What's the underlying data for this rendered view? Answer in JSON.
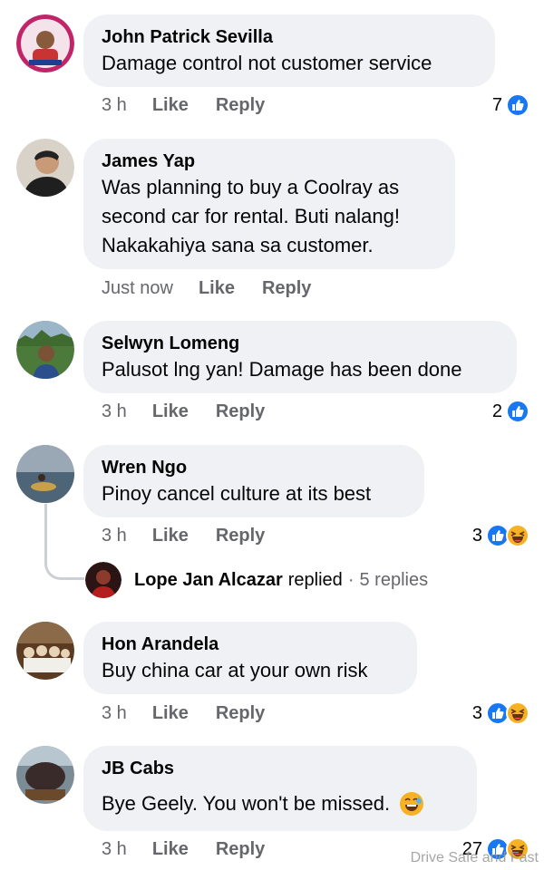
{
  "comments": [
    {
      "name": "John Patrick Sevilla",
      "lines": [
        "Damage control not customer service"
      ],
      "time": "3 h",
      "like_label": "Like",
      "reply_label": "Reply",
      "reaction_count": "7",
      "reactions": [
        "like-icon"
      ]
    },
    {
      "name": "James Yap",
      "lines": [
        "Was planning to buy a Coolray as",
        "second car for rental. Buti nalang!",
        "Nakakahiya sana sa customer."
      ],
      "time": "Just now",
      "like_label": "Like",
      "reply_label": "Reply",
      "reaction_count": "",
      "reactions": []
    },
    {
      "name": "Selwyn Lomeng",
      "lines": [
        "Palusot lng yan! Damage has been done"
      ],
      "time": "3 h",
      "like_label": "Like",
      "reply_label": "Reply",
      "reaction_count": "2",
      "reactions": [
        "like-icon"
      ]
    },
    {
      "name": "Wren Ngo",
      "lines": [
        "Pinoy cancel culture at its best"
      ],
      "time": "3 h",
      "like_label": "Like",
      "reply_label": "Reply",
      "reaction_count": "3",
      "reactions": [
        "like-icon",
        "haha-icon"
      ]
    },
    {
      "name": "Hon Arandela",
      "lines": [
        "Buy china car at your own risk"
      ],
      "time": "3 h",
      "like_label": "Like",
      "reply_label": "Reply",
      "reaction_count": "3",
      "reactions": [
        "like-icon",
        "haha-icon"
      ]
    },
    {
      "name": "JB Cabs",
      "lines": [
        "Bye Geely. You won't be missed."
      ],
      "time": "3 h",
      "like_label": "Like",
      "reply_label": "Reply",
      "reaction_count": "27",
      "reactions": [
        "like-icon",
        "haha-icon"
      ]
    }
  ],
  "reply_thread": {
    "name": "Lope Jan Alcazar",
    "action": "replied",
    "separator": "·",
    "count": "5 replies"
  },
  "watermark": "Drive Safe and Fast",
  "colors": {
    "bubble": "#eff1f4",
    "like_blue": "#1877f2",
    "haha_yellow": "#f7b125",
    "secondary_text": "#65676b"
  }
}
